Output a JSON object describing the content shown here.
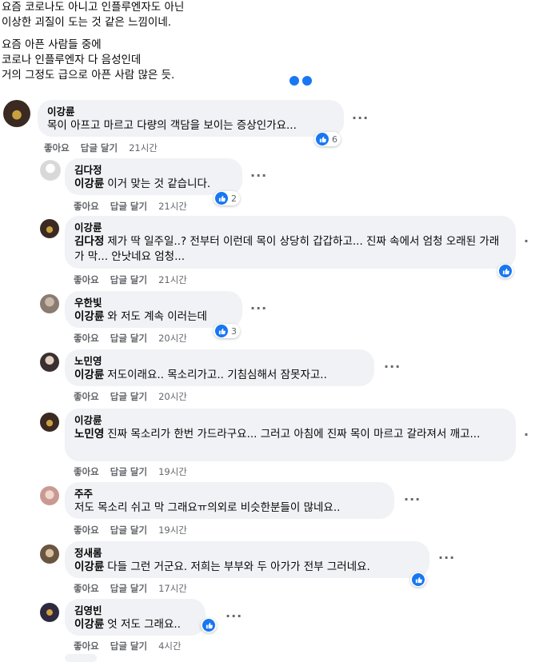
{
  "post": {
    "lines": [
      "요즘 코로나도 아니고 인플루엔자도 아닌",
      "이상한 괴질이 도는 것 같은 느낌이네.",
      "",
      "요즘 아픈 사람들 중에",
      "코로나 인플루엔자 다 음성인데",
      "거의 그정도 급으로 아픈 사람 많은 듯."
    ]
  },
  "actions": {
    "like": "좋아요",
    "reply": "답글 달기"
  },
  "colors": {
    "like_blue": "#1877f2",
    "bubble": "#f0f2f5",
    "meta_gray": "#65676b"
  },
  "comments": [
    {
      "author": "이강륜",
      "mention": "",
      "text": "목이 아프고 마르고 다량의 객담을 보이는 증상인가요...",
      "time": "21시간",
      "reactions": "6"
    },
    {
      "author": "김다정",
      "mention": "이강륜",
      "text": "이거 맞는 것 같습니다.",
      "time": "21시간",
      "reactions": "2"
    },
    {
      "author": "이강륜",
      "mention": "김다정",
      "text": "제가 딱 일주일..? 전부터 이런데 목이 상당히 갑갑하고... 진짜 속에서 엄청 오래된 가래가 막... 안낫네요 엄청...",
      "time": "21시간",
      "reactions": ""
    },
    {
      "author": "우한빛",
      "mention": "이강륜",
      "text": "와 저도 계속 이러는데",
      "time": "20시간",
      "reactions": "3"
    },
    {
      "author": "노민영",
      "mention": "이강륜",
      "text": "저도이래요.. 목소리가고.. 기침심해서 잠못자고..",
      "time": "20시간",
      "reactions": ""
    },
    {
      "author": "이강륜",
      "mention": "노민영",
      "text": "진짜 목소리가 한번 가드라구요... 그러고 아침에 진짜 목이 마르고 갈라져서 깨고...",
      "time": "19시간",
      "reactions": ""
    },
    {
      "author": "주주",
      "mention": "",
      "text": "저도 목소리 쉬고 막 그래요ㅠ의외로 비슷한분들이 많네요..",
      "time": "19시간",
      "reactions": ""
    },
    {
      "author": "정새롬",
      "mention": "이강륜",
      "text": "다들 그런 거군요. 저희는 부부와 두 아가가 전부 그러네요.",
      "time": "17시간",
      "reactions": ""
    },
    {
      "author": "김영빈",
      "mention": "이강륜",
      "text": "엇 저도 그래요..",
      "time": "4시간",
      "reactions": ""
    }
  ]
}
